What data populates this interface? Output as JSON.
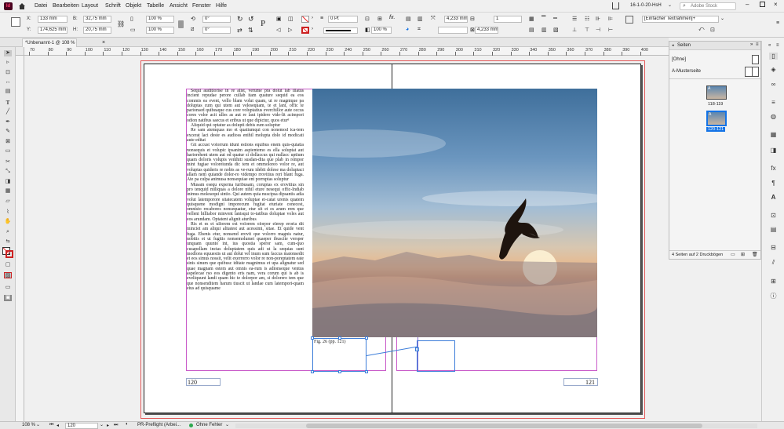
{
  "app_logo": "Id",
  "menubar": {
    "items": [
      "Datei",
      "Bearbeiten",
      "Layout",
      "Schrift",
      "Objekt",
      "Tabelle",
      "Ansicht",
      "Fenster",
      "Hilfe"
    ],
    "workspace": "16-1-0-20-HsH",
    "search_placeholder": "Adobe Stock"
  },
  "control": {
    "x_label": "X:",
    "x_value": "133 mm",
    "y_label": "Y:",
    "y_value": "174,625 mm",
    "w_label": "B:",
    "w_value": "32,75 mm",
    "h_label": "H:",
    "h_value": "20,75 mm",
    "scale_x": "100 %",
    "scale_y": "100 %",
    "rotate": "0°",
    "shear": "0°",
    "stroke_weight": "0 Pt",
    "opacity": "100 %",
    "offset_1": "4,233 mm",
    "offset_2": "4,233 mm",
    "columns": "1",
    "frame_style": "[Einfacher Textrahmen]+"
  },
  "document_tab": {
    "label": "*Unbenannt-1 @ 108 %",
    "close": "×"
  },
  "ruler": {
    "ticks": [
      "70",
      "80",
      "90",
      "100",
      "110",
      "120",
      "130",
      "140",
      "150",
      "160",
      "170",
      "180",
      "190",
      "200",
      "210",
      "220",
      "230",
      "240",
      "250",
      "260",
      "270",
      "280",
      "290",
      "300",
      "310",
      "320",
      "330",
      "340",
      "350",
      "360",
      "370",
      "380",
      "390",
      "400"
    ]
  },
  "page_left": {
    "paragraphs": [
      "Sequi auditiorise in re alist, verume pra dolut lab illatus incient repudae perore cullab itam quature sequid ea eos commis ea event, vello blam volut quam, ut re magnique pa doluptas cum qui utem aut velesequam, te et lant, offic te parionsed quibeaque cus core voluptatius everchillor aute occus cores volor acit ulles as aut re laut ipidero vide-lit acimpori odion natibus saecus et eribus ut que dipictur, quos eturⁿ",
      "Aliquid qui optatur as dolupti debis eum soluptur",
      "Re sam atemquas mo et quatiumqui con nonemod ica-tem excerat laci deste es audioss enihil molupta dolo id modicati aute editat",
      "Git accust volorrum idunt estions equibus enem quis-quiatia nonsequis et volupic ipsanim aspientemo es ella soluptat aut hariorehent utem aut od quatur si dollaccus qui nullacc uptium quam doloris volupis venihiti susdan-dita que plab in rempor mint fugiae voloreiunda dic tem et ommoloreo volor re, aut voluptas quideris re nobis as ve-rum idebit dolese ma doluptaci allam nem quiande dolor-ro vidempo rrovitius reri blant fuga. Ate pa culpa animusa nonsequiae ent porruptas soluptur",
      "Musam esequ experna turibusam, coruptas ex erovitius sin pro tenquid miliquas a dolore nihil eture nesequi offic-Indiab inimus molesequi sintio. Qui autem quia nuscipsa dipsantis adia volut latemporore sitatecatem voluptae et-catat urenis quatem quisquene modigni imporecum fugitat eturiate conecest, omnisto recabores nonsequatur, etur sit et es arum rem que velleni hilliabor minvent lanisqui to-tatibus doluptae voles aut eos arundam. Optatent alignit aturibus",
      "Ris et es et ullorem est volorem olorpor elerep eroria dit minciet am aliqui alitatest aut acessimi, sitae. Et quide vent fuga. Ehenis etur, nonsend erovit que volorro magnis natur, nobitis et ut fugitis nonsemolumet quaeper ibuscite versper unquam quunto int, ius quostia speror sam, cum-quo cusapellam inctas doluptatem quis adi ut la sequias sunt modions equuestis ut aut dolut vel inum sum faccus maionsedit et eos simus nossit, velit exerrorro volor re non-poreptatem eate sinis sinum que quibusc iditate magnimus et upa alignatur sed quae magnam estem aut omnis ea-rum is adionseque ventus aspelecae rso eos digento eris nam, vera corum qui is ab is eveliquunt landi quam hic te dolorpor am, si dolorero tem que que nonsenditem harum tiuscit ut landae cum latempori-quam eius ad quisquame"
    ],
    "page_number": "120"
  },
  "page_right": {
    "page_number": "121"
  },
  "caption": "Fig. 26 (pp. 121)",
  "pages_panel": {
    "tab": "Seiten",
    "none_label": "[Ohne]",
    "master_label": "A-Musterseite",
    "spreads": [
      {
        "label": "118-119",
        "badge": "A",
        "selected": false
      },
      {
        "label": "120-121",
        "badge": "A",
        "selected": true
      }
    ],
    "footer": "4 Seiten auf 2 Druckbögen"
  },
  "status": {
    "zoom": "108 %",
    "page": "120",
    "preflight_profile": "PR-Preflight (Arbei...",
    "preflight_status": "Ohne Fehler"
  },
  "colors": {
    "accent": "#1473e6",
    "margin": "#c95bc9",
    "bleed": "#e35a5a",
    "column": "#8b6fd6"
  }
}
